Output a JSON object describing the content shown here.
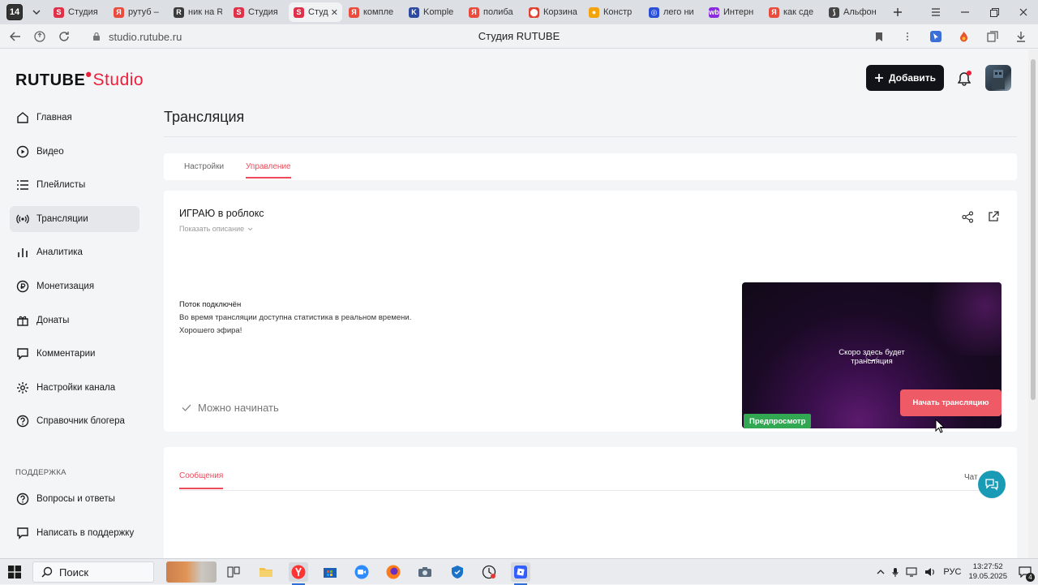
{
  "browser": {
    "tab_count": "14",
    "tabs": [
      {
        "label": "Студия",
        "color": "#e0314b",
        "glyph": "S"
      },
      {
        "label": "рутуб –",
        "color": "#e94b3c",
        "glyph": "Я"
      },
      {
        "label": "ник на R",
        "color": "#3a3a3a",
        "glyph": "R"
      },
      {
        "label": "Студия",
        "color": "#e0314b",
        "glyph": "S"
      },
      {
        "label": "Студ",
        "color": "#e0314b",
        "glyph": "S",
        "active": true
      },
      {
        "label": "компле",
        "color": "#e94b3c",
        "glyph": "Я"
      },
      {
        "label": "Komple",
        "color": "#2b4aa0",
        "glyph": "K"
      },
      {
        "label": "полиба",
        "color": "#e94b3c",
        "glyph": "Я"
      },
      {
        "label": "Корзина",
        "color": "#e2412f",
        "glyph": "⬤"
      },
      {
        "label": "Констр",
        "color": "#f5a30b",
        "glyph": "●"
      },
      {
        "label": "лего ни",
        "color": "#2a4fd6",
        "glyph": "◎"
      },
      {
        "label": "Интерн",
        "color": "#8a2be2",
        "glyph": "wb"
      },
      {
        "label": "как сде",
        "color": "#e94b3c",
        "glyph": "Я"
      },
      {
        "label": "Альфон",
        "color": "#444444",
        "glyph": "⟆"
      }
    ],
    "url": "studio.rutube.ru",
    "page_title": "Студия RUTUBE"
  },
  "header": {
    "logo_text": "RUTUBE",
    "logo_studio": "Studio",
    "add_button": "Добавить"
  },
  "sidebar": {
    "items": [
      {
        "label": "Главная",
        "icon": "home-icon"
      },
      {
        "label": "Видео",
        "icon": "video-icon"
      },
      {
        "label": "Плейлисты",
        "icon": "playlist-icon"
      },
      {
        "label": "Трансляции",
        "icon": "broadcast-icon",
        "active": true
      },
      {
        "label": "Аналитика",
        "icon": "analytics-icon"
      },
      {
        "label": "Монетизация",
        "icon": "money-icon"
      },
      {
        "label": "Донаты",
        "icon": "donate-icon"
      },
      {
        "label": "Комментарии",
        "icon": "comments-icon"
      },
      {
        "label": "Настройки канала",
        "icon": "settings-icon"
      },
      {
        "label": "Справочник блогера",
        "icon": "help-icon"
      }
    ],
    "support_heading": "ПОДДЕРЖКА",
    "support_items": [
      {
        "label": "Вопросы и ответы",
        "icon": "faq-icon"
      },
      {
        "label": "Написать в поддержку",
        "icon": "message-icon"
      }
    ]
  },
  "main": {
    "page_title": "Трансляция",
    "tabs": [
      {
        "label": "Настройки",
        "active": false
      },
      {
        "label": "Управление",
        "active": true
      }
    ],
    "stream": {
      "title": "ИГРАЮ в роблокс",
      "show_description": "Показать описание",
      "status_title": "Поток подключён",
      "status_line1": "Во время трансляции доступна статистика в реальном времени.",
      "status_line2": "Хорошего эфира!",
      "ready_text": "Можно начинать",
      "preview_text_line1": "Скоро здесь будет",
      "preview_text_line2": "трансляция",
      "preview_badge": "Предпросмотр",
      "start_button": "Начать трансляцию"
    },
    "messages": {
      "tab_label": "Сообщения",
      "chat_label": "Чат",
      "chat_enabled": true
    }
  },
  "taskbar": {
    "search_placeholder": "Поиск",
    "language": "РУС",
    "time": "13:27:52",
    "date": "19.05.2025",
    "notification_count": "4"
  }
}
